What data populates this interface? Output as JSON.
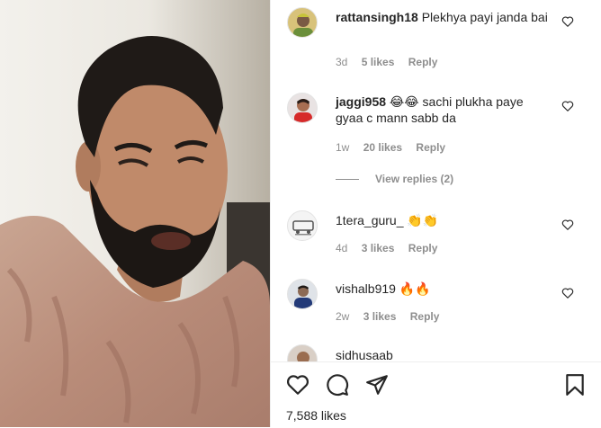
{
  "comments": [
    {
      "username": "rattansingh18",
      "text": "Plekhya payi janda bai",
      "time": "3d",
      "likes": "5 likes",
      "reply": "Reply"
    },
    {
      "username": "jaggi958",
      "emoji": "😂😂",
      "text": "sachi plukha paye gyaa c mann sabb da",
      "time": "1w",
      "likes": "20 likes",
      "reply": "Reply"
    },
    {
      "username": "1tera_guru_",
      "emoji": "👏👏",
      "text": "",
      "time": "4d",
      "likes": "3 likes",
      "reply": "Reply"
    },
    {
      "username": "vishalb919",
      "emoji": "🔥🔥",
      "text": "",
      "time": "2w",
      "likes": "3 likes",
      "reply": "Reply"
    },
    {
      "username": "sidhusaab",
      "text": ""
    }
  ],
  "view_replies": "View replies (2)",
  "post": {
    "likes": "7,588 likes"
  },
  "icons": {
    "like": "heart-outline-icon",
    "comment": "speech-bubble-icon",
    "share": "paper-plane-icon",
    "save": "bookmark-icon",
    "comment_like": "small-heart-icon"
  }
}
